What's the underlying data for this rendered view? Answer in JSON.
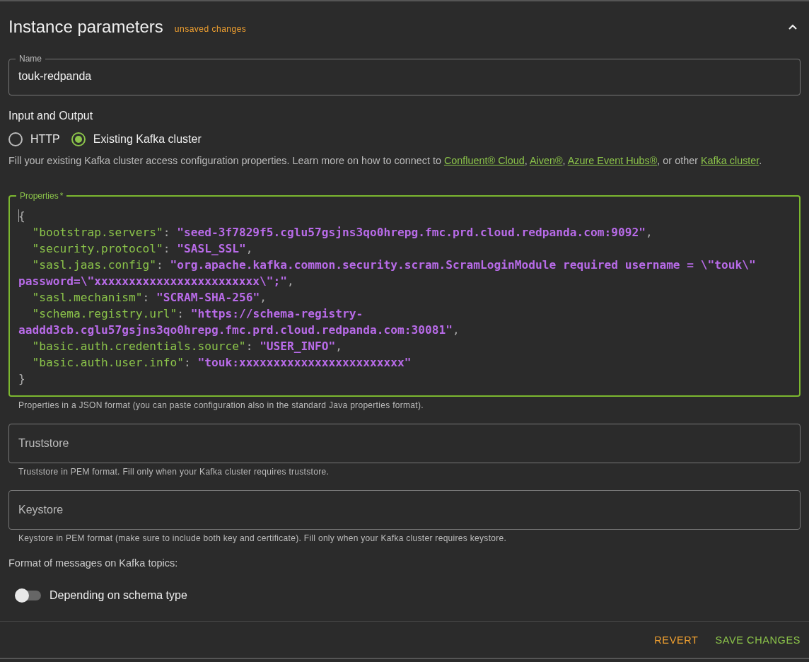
{
  "panel": {
    "title": "Instance parameters",
    "status": "unsaved changes",
    "expanded": true
  },
  "name_field": {
    "label": "Name",
    "value": "touk-redpanda"
  },
  "io": {
    "heading": "Input and Output",
    "options": [
      {
        "label": "HTTP",
        "selected": false
      },
      {
        "label": "Existing Kafka cluster",
        "selected": true
      }
    ],
    "description": [
      {
        "kind": "text",
        "text": "Fill your existing Kafka cluster access configuration properties. Learn more on how to connect to "
      },
      {
        "kind": "link",
        "text": "Confluent® Cloud"
      },
      {
        "kind": "text",
        "text": ", "
      },
      {
        "kind": "link",
        "text": "Aiven®"
      },
      {
        "kind": "text",
        "text": ", "
      },
      {
        "kind": "link",
        "text": "Azure Event Hubs®"
      },
      {
        "kind": "text",
        "text": ", or other "
      },
      {
        "kind": "link",
        "text": "Kafka cluster"
      },
      {
        "kind": "text",
        "text": "."
      }
    ]
  },
  "properties": {
    "label": "Properties",
    "required_mark": "*",
    "focused": true,
    "helper": "Properties in a JSON format (you can paste configuration also in the standard Java properties format).",
    "lines": [
      {
        "indented": false,
        "tokens": [
          {
            "kind": "punct",
            "text": "{"
          }
        ]
      },
      {
        "indented": true,
        "tokens": [
          {
            "kind": "key",
            "text": "\"bootstrap.servers\""
          },
          {
            "kind": "punct",
            "text": ": "
          },
          {
            "kind": "string",
            "text": "\"seed-3f7829f5.cglu57gsjns3qo0hrepg.fmc.prd.cloud.redpanda.com:9092\""
          },
          {
            "kind": "punct",
            "text": ","
          }
        ]
      },
      {
        "indented": true,
        "tokens": [
          {
            "kind": "key",
            "text": "\"security.protocol\""
          },
          {
            "kind": "punct",
            "text": ": "
          },
          {
            "kind": "string",
            "text": "\"SASL_SSL\""
          },
          {
            "kind": "punct",
            "text": ","
          }
        ]
      },
      {
        "indented": true,
        "tokens": [
          {
            "kind": "key",
            "text": "\"sasl.jaas.config\""
          },
          {
            "kind": "punct",
            "text": ": "
          },
          {
            "kind": "string",
            "text": "\"org.apache.kafka.common.security.scram.ScramLoginModule required username = \\\"touk\\\""
          }
        ]
      },
      {
        "indented": false,
        "tokens": [
          {
            "kind": "string",
            "text": "password=\\\"xxxxxxxxxxxxxxxxxxxxxxxx\\\";\""
          },
          {
            "kind": "punct",
            "text": ","
          }
        ]
      },
      {
        "indented": true,
        "tokens": [
          {
            "kind": "key",
            "text": "\"sasl.mechanism\""
          },
          {
            "kind": "punct",
            "text": ": "
          },
          {
            "kind": "string",
            "text": "\"SCRAM-SHA-256\""
          },
          {
            "kind": "punct",
            "text": ","
          }
        ]
      },
      {
        "indented": true,
        "tokens": [
          {
            "kind": "key",
            "text": "\"schema.registry.url\""
          },
          {
            "kind": "punct",
            "text": ": "
          },
          {
            "kind": "string",
            "text": "\"https://schema-registry-"
          }
        ]
      },
      {
        "indented": false,
        "tokens": [
          {
            "kind": "string",
            "text": "aaddd3cb.cglu57gsjns3qo0hrepg.fmc.prd.cloud.redpanda.com:30081\""
          },
          {
            "kind": "punct",
            "text": ","
          }
        ]
      },
      {
        "indented": true,
        "tokens": [
          {
            "kind": "key",
            "text": "\"basic.auth.credentials.source\""
          },
          {
            "kind": "punct",
            "text": ": "
          },
          {
            "kind": "string",
            "text": "\"USER_INFO\""
          },
          {
            "kind": "punct",
            "text": ","
          }
        ]
      },
      {
        "indented": true,
        "tokens": [
          {
            "kind": "key",
            "text": "\"basic.auth.user.info\""
          },
          {
            "kind": "punct",
            "text": ": "
          },
          {
            "kind": "string",
            "text": "\"touk:xxxxxxxxxxxxxxxxxxxxxxxx\""
          }
        ]
      },
      {
        "indented": false,
        "tokens": [
          {
            "kind": "punct",
            "text": "}"
          }
        ]
      }
    ]
  },
  "truststore": {
    "placeholder": "Truststore",
    "helper": "Truststore in PEM format. Fill only when your Kafka cluster requires truststore."
  },
  "keystore": {
    "placeholder": "Keystore",
    "helper": "Keystore in PEM format (make sure to include both key and certificate). Fill only when your Kafka cluster requires keystore."
  },
  "format": {
    "heading": "Format of messages on Kafka topics:",
    "switch": {
      "label": "Depending on schema type",
      "on": false
    }
  },
  "actions": [
    {
      "kind": "revert",
      "label": "REVERT"
    },
    {
      "kind": "save",
      "label": "SAVE CHANGES"
    }
  ]
}
